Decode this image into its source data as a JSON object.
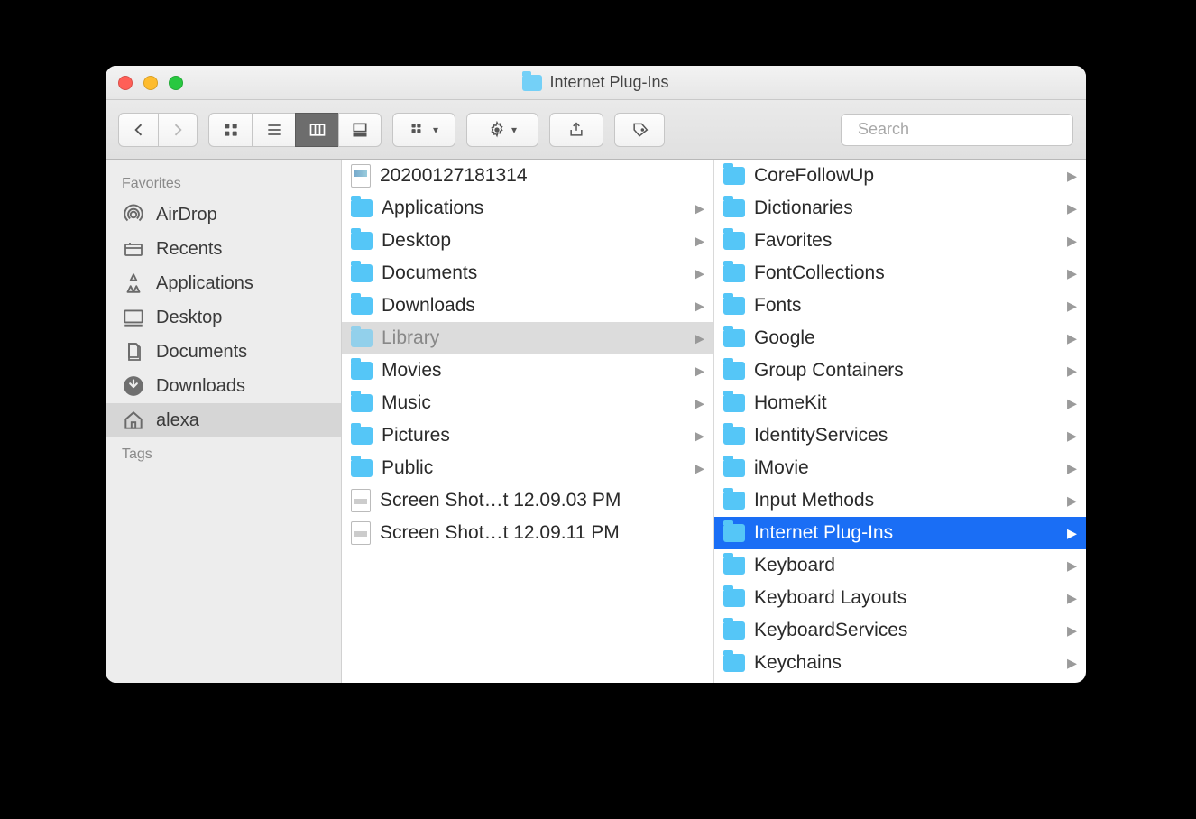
{
  "window": {
    "title": "Internet Plug-Ins"
  },
  "search": {
    "placeholder": "Search"
  },
  "sidebar": {
    "favorites_header": "Favorites",
    "tags_header": "Tags",
    "items": [
      {
        "label": "AirDrop",
        "icon": "airdrop"
      },
      {
        "label": "Recents",
        "icon": "recents"
      },
      {
        "label": "Applications",
        "icon": "apps"
      },
      {
        "label": "Desktop",
        "icon": "desktop"
      },
      {
        "label": "Documents",
        "icon": "documents"
      },
      {
        "label": "Downloads",
        "icon": "downloads"
      },
      {
        "label": "alexa",
        "icon": "home",
        "selected": true
      }
    ]
  },
  "columns": [
    {
      "items": [
        {
          "label": "20200127181314",
          "type": "file"
        },
        {
          "label": "Applications",
          "type": "folder",
          "expand": true
        },
        {
          "label": "Desktop",
          "type": "folder",
          "expand": true
        },
        {
          "label": "Documents",
          "type": "folder",
          "expand": true
        },
        {
          "label": "Downloads",
          "type": "folder",
          "expand": true
        },
        {
          "label": "Library",
          "type": "folder",
          "expand": true,
          "state": "selgrey"
        },
        {
          "label": "Movies",
          "type": "folder",
          "expand": true
        },
        {
          "label": "Music",
          "type": "folder",
          "expand": true
        },
        {
          "label": "Pictures",
          "type": "folder",
          "expand": true
        },
        {
          "label": "Public",
          "type": "folder",
          "expand": true
        },
        {
          "label": "Screen Shot…t 12.09.03 PM",
          "type": "png"
        },
        {
          "label": "Screen Shot…t 12.09.11 PM",
          "type": "png"
        }
      ]
    },
    {
      "items": [
        {
          "label": "CoreFollowUp",
          "type": "folder",
          "expand": true
        },
        {
          "label": "Dictionaries",
          "type": "folder",
          "expand": true
        },
        {
          "label": "Favorites",
          "type": "folder",
          "expand": true
        },
        {
          "label": "FontCollections",
          "type": "folder",
          "expand": true
        },
        {
          "label": "Fonts",
          "type": "folder",
          "expand": true
        },
        {
          "label": "Google",
          "type": "folder",
          "expand": true
        },
        {
          "label": "Group Containers",
          "type": "folder",
          "expand": true
        },
        {
          "label": "HomeKit",
          "type": "folder",
          "expand": true
        },
        {
          "label": "IdentityServices",
          "type": "folder",
          "expand": true
        },
        {
          "label": "iMovie",
          "type": "folder",
          "expand": true
        },
        {
          "label": "Input Methods",
          "type": "folder",
          "expand": true
        },
        {
          "label": "Internet Plug-Ins",
          "type": "folder",
          "expand": true,
          "state": "selblue"
        },
        {
          "label": "Keyboard",
          "type": "folder",
          "expand": true
        },
        {
          "label": "Keyboard Layouts",
          "type": "folder",
          "expand": true
        },
        {
          "label": "KeyboardServices",
          "type": "folder",
          "expand": true
        },
        {
          "label": "Keychains",
          "type": "folder",
          "expand": true
        }
      ]
    }
  ]
}
